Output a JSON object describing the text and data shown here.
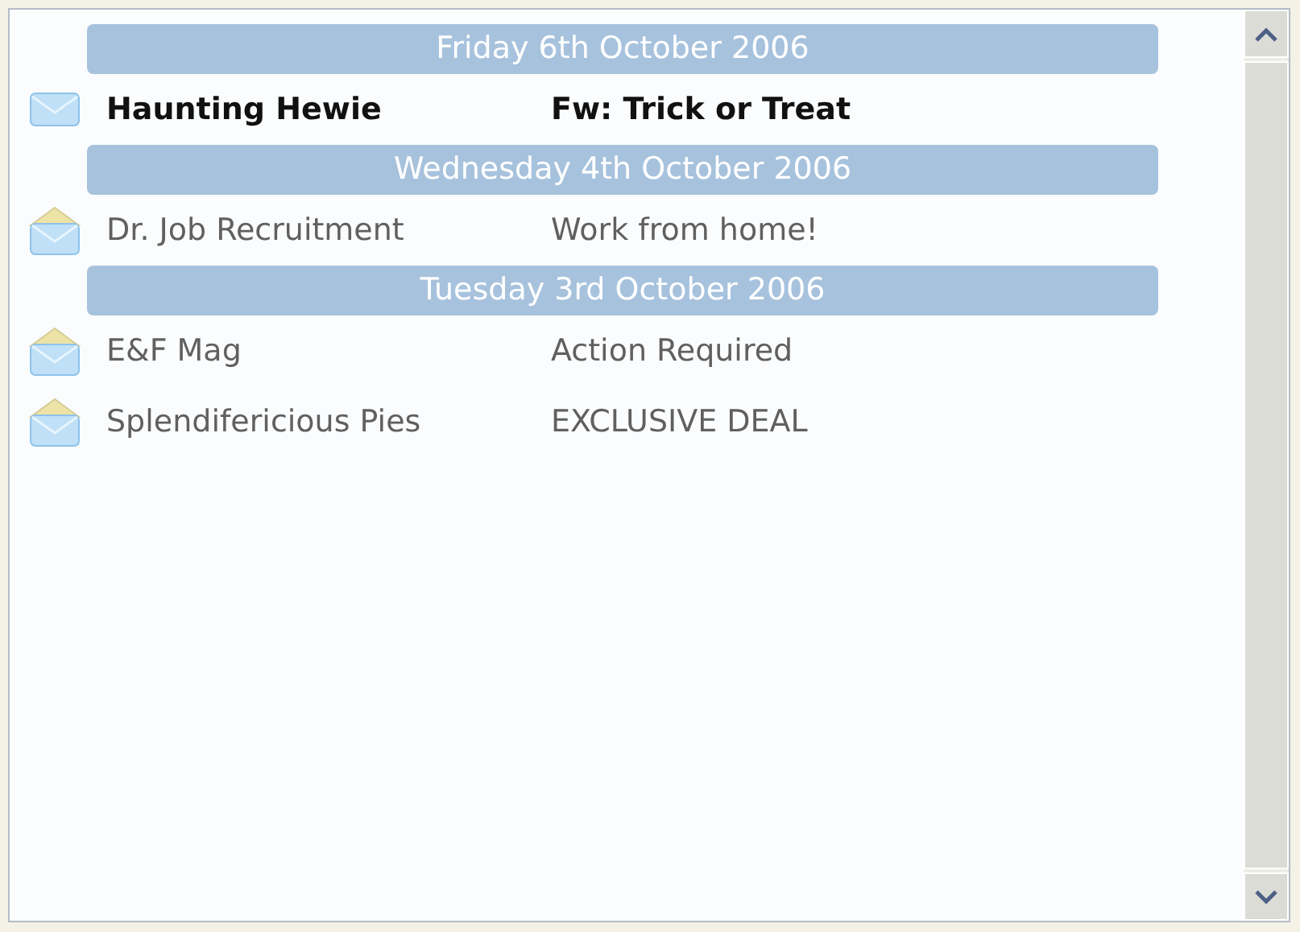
{
  "groups": [
    {
      "date": "Friday 6th October 2006",
      "messages": [
        {
          "sender": "Haunting Hewie",
          "subject": "Fw: Trick or Treat",
          "unread": true
        }
      ]
    },
    {
      "date": "Wednesday 4th October 2006",
      "messages": [
        {
          "sender": "Dr. Job Recruitment",
          "subject": "Work from home!",
          "unread": false
        }
      ]
    },
    {
      "date": "Tuesday 3rd October 2006",
      "messages": [
        {
          "sender": "E&F Mag",
          "subject": "Action Required",
          "unread": false
        },
        {
          "sender": "Splendifericious Pies",
          "subject": "EXCLUSIVE DEAL",
          "unread": false
        }
      ]
    }
  ]
}
